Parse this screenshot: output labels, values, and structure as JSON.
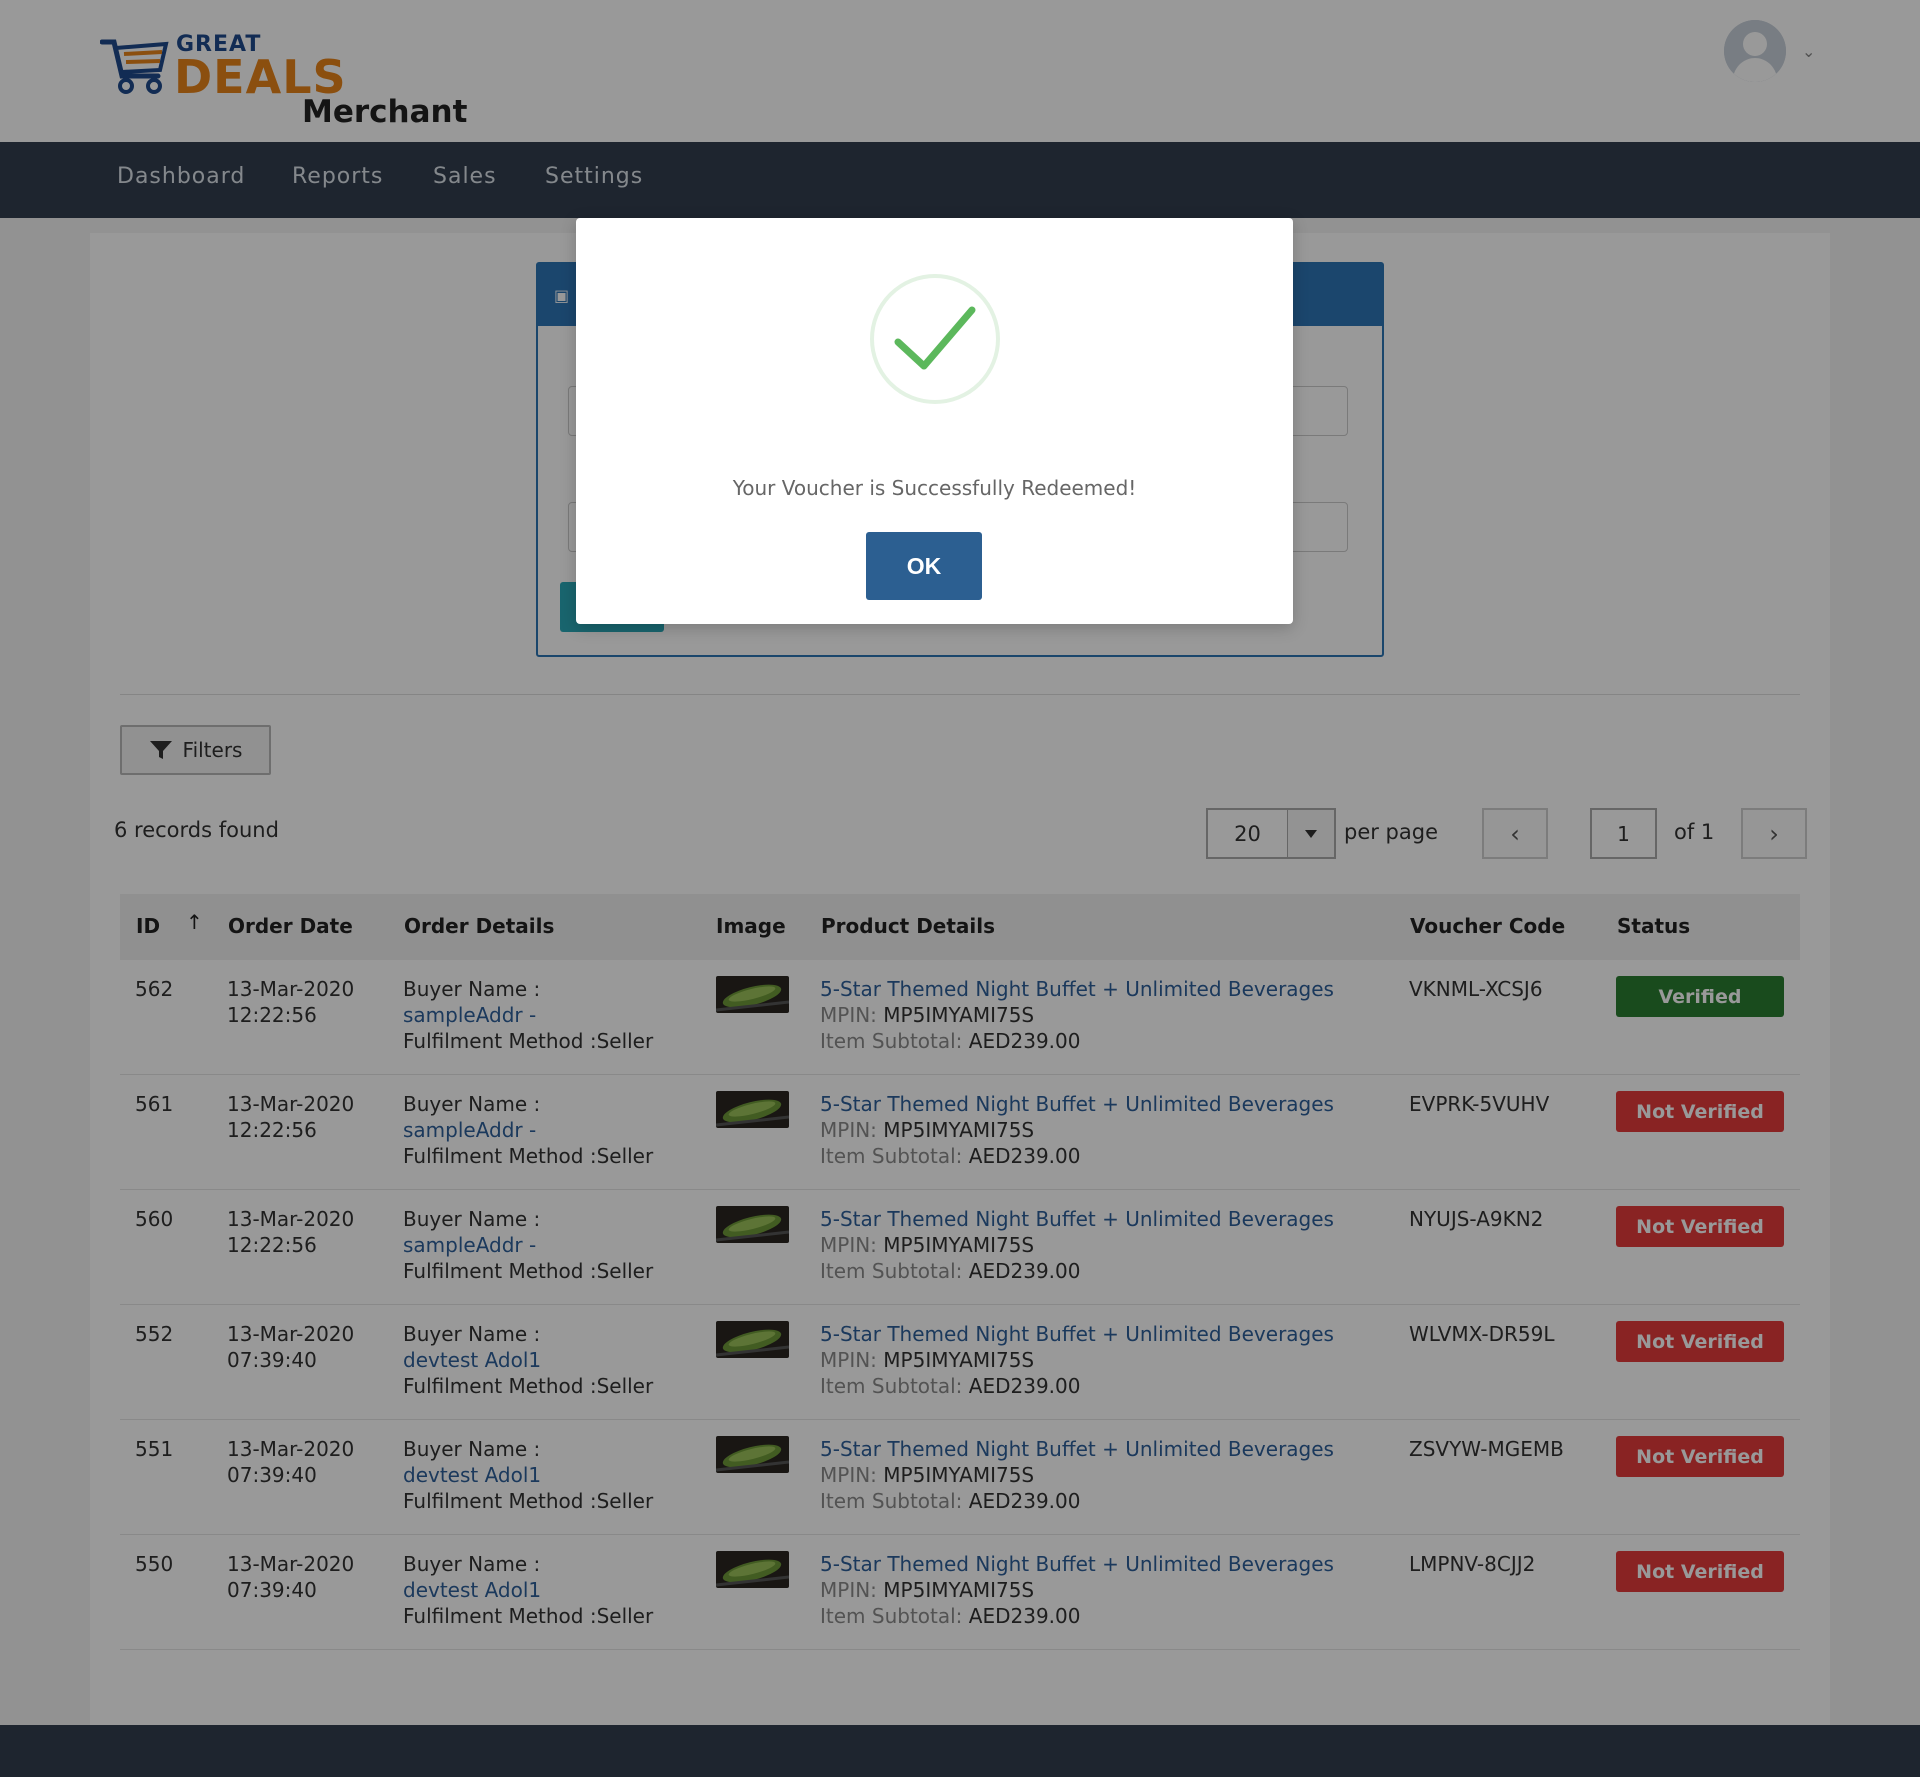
{
  "header": {
    "logo": {
      "great": "GREAT",
      "deals": "DEALS",
      "merchant": "Merchant"
    }
  },
  "nav": {
    "items": [
      "Dashboard",
      "Reports",
      "Sales",
      "Settings"
    ]
  },
  "list": {
    "filters_label": "Filters",
    "records_found": "6 records found",
    "per_page_value": "20",
    "per_page_label": "per page",
    "page_current": "1",
    "page_total": "of 1"
  },
  "table": {
    "columns": [
      "ID",
      "Order Date",
      "Order Details",
      "Image",
      "Product Details",
      "Voucher Code",
      "Status"
    ],
    "rows": [
      {
        "id": "562",
        "date": "13-Mar-2020",
        "time": "12:22:56",
        "buyer_label": "Buyer Name :",
        "buyer": "sampleAddr -",
        "fulfilment": "Fulfilment Method :Seller",
        "product": "5-Star Themed Night Buffet + Unlimited Beverages",
        "mpin_label": "MPIN:",
        "mpin": "MP5IMYAMI75S",
        "subtotal_label": "Item Subtotal:",
        "subtotal": "AED239.00",
        "voucher": "VKNML-XCSJ6",
        "status": "Verified"
      },
      {
        "id": "561",
        "date": "13-Mar-2020",
        "time": "12:22:56",
        "buyer_label": "Buyer Name :",
        "buyer": "sampleAddr -",
        "fulfilment": "Fulfilment Method :Seller",
        "product": "5-Star Themed Night Buffet + Unlimited Beverages",
        "mpin_label": "MPIN:",
        "mpin": "MP5IMYAMI75S",
        "subtotal_label": "Item Subtotal:",
        "subtotal": "AED239.00",
        "voucher": "EVPRK-5VUHV",
        "status": "Not Verified"
      },
      {
        "id": "560",
        "date": "13-Mar-2020",
        "time": "12:22:56",
        "buyer_label": "Buyer Name :",
        "buyer": "sampleAddr -",
        "fulfilment": "Fulfilment Method :Seller",
        "product": "5-Star Themed Night Buffet + Unlimited Beverages",
        "mpin_label": "MPIN:",
        "mpin": "MP5IMYAMI75S",
        "subtotal_label": "Item Subtotal:",
        "subtotal": "AED239.00",
        "voucher": "NYUJS-A9KN2",
        "status": "Not Verified"
      },
      {
        "id": "552",
        "date": "13-Mar-2020",
        "time": "07:39:40",
        "buyer_label": "Buyer Name :",
        "buyer": "devtest Adol1",
        "fulfilment": "Fulfilment Method :Seller",
        "product": "5-Star Themed Night Buffet + Unlimited Beverages",
        "mpin_label": "MPIN:",
        "mpin": "MP5IMYAMI75S",
        "subtotal_label": "Item Subtotal:",
        "subtotal": "AED239.00",
        "voucher": "WLVMX-DR59L",
        "status": "Not Verified"
      },
      {
        "id": "551",
        "date": "13-Mar-2020",
        "time": "07:39:40",
        "buyer_label": "Buyer Name :",
        "buyer": "devtest Adol1",
        "fulfilment": "Fulfilment Method :Seller",
        "product": "5-Star Themed Night Buffet + Unlimited Beverages",
        "mpin_label": "MPIN:",
        "mpin": "MP5IMYAMI75S",
        "subtotal_label": "Item Subtotal:",
        "subtotal": "AED239.00",
        "voucher": "ZSVYW-MGEMB",
        "status": "Not Verified"
      },
      {
        "id": "550",
        "date": "13-Mar-2020",
        "time": "07:39:40",
        "buyer_label": "Buyer Name :",
        "buyer": "devtest Adol1",
        "fulfilment": "Fulfilment Method :Seller",
        "product": "5-Star Themed Night Buffet + Unlimited Beverages",
        "mpin_label": "MPIN:",
        "mpin": "MP5IMYAMI75S",
        "subtotal_label": "Item Subtotal:",
        "subtotal": "AED239.00",
        "voucher": "LMPNV-8CJJ2",
        "status": "Not Verified"
      }
    ]
  },
  "modal": {
    "message": "Your Voucher is Successfully Redeemed!",
    "ok_label": "OK"
  },
  "colors": {
    "nav_bg": "#323f4f",
    "panel_blue": "#2d75b6",
    "verified": "#2b7d31",
    "not_verified": "#e53b3b",
    "ok_button": "#2c5f91",
    "success_green": "#5cb85c"
  }
}
